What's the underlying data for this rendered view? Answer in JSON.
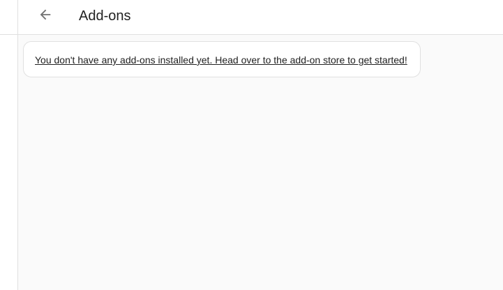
{
  "header": {
    "title": "Add-ons",
    "back_icon": "arrow-left-icon"
  },
  "main": {
    "empty_state_link": "You don't have any add-ons installed yet. Head over to the add-on store to get started!"
  },
  "colors": {
    "header_bg": "#ffffff",
    "page_bg": "#fafafa",
    "divider": "#e0e0e0",
    "text_primary": "#212121",
    "icon": "#727272"
  }
}
